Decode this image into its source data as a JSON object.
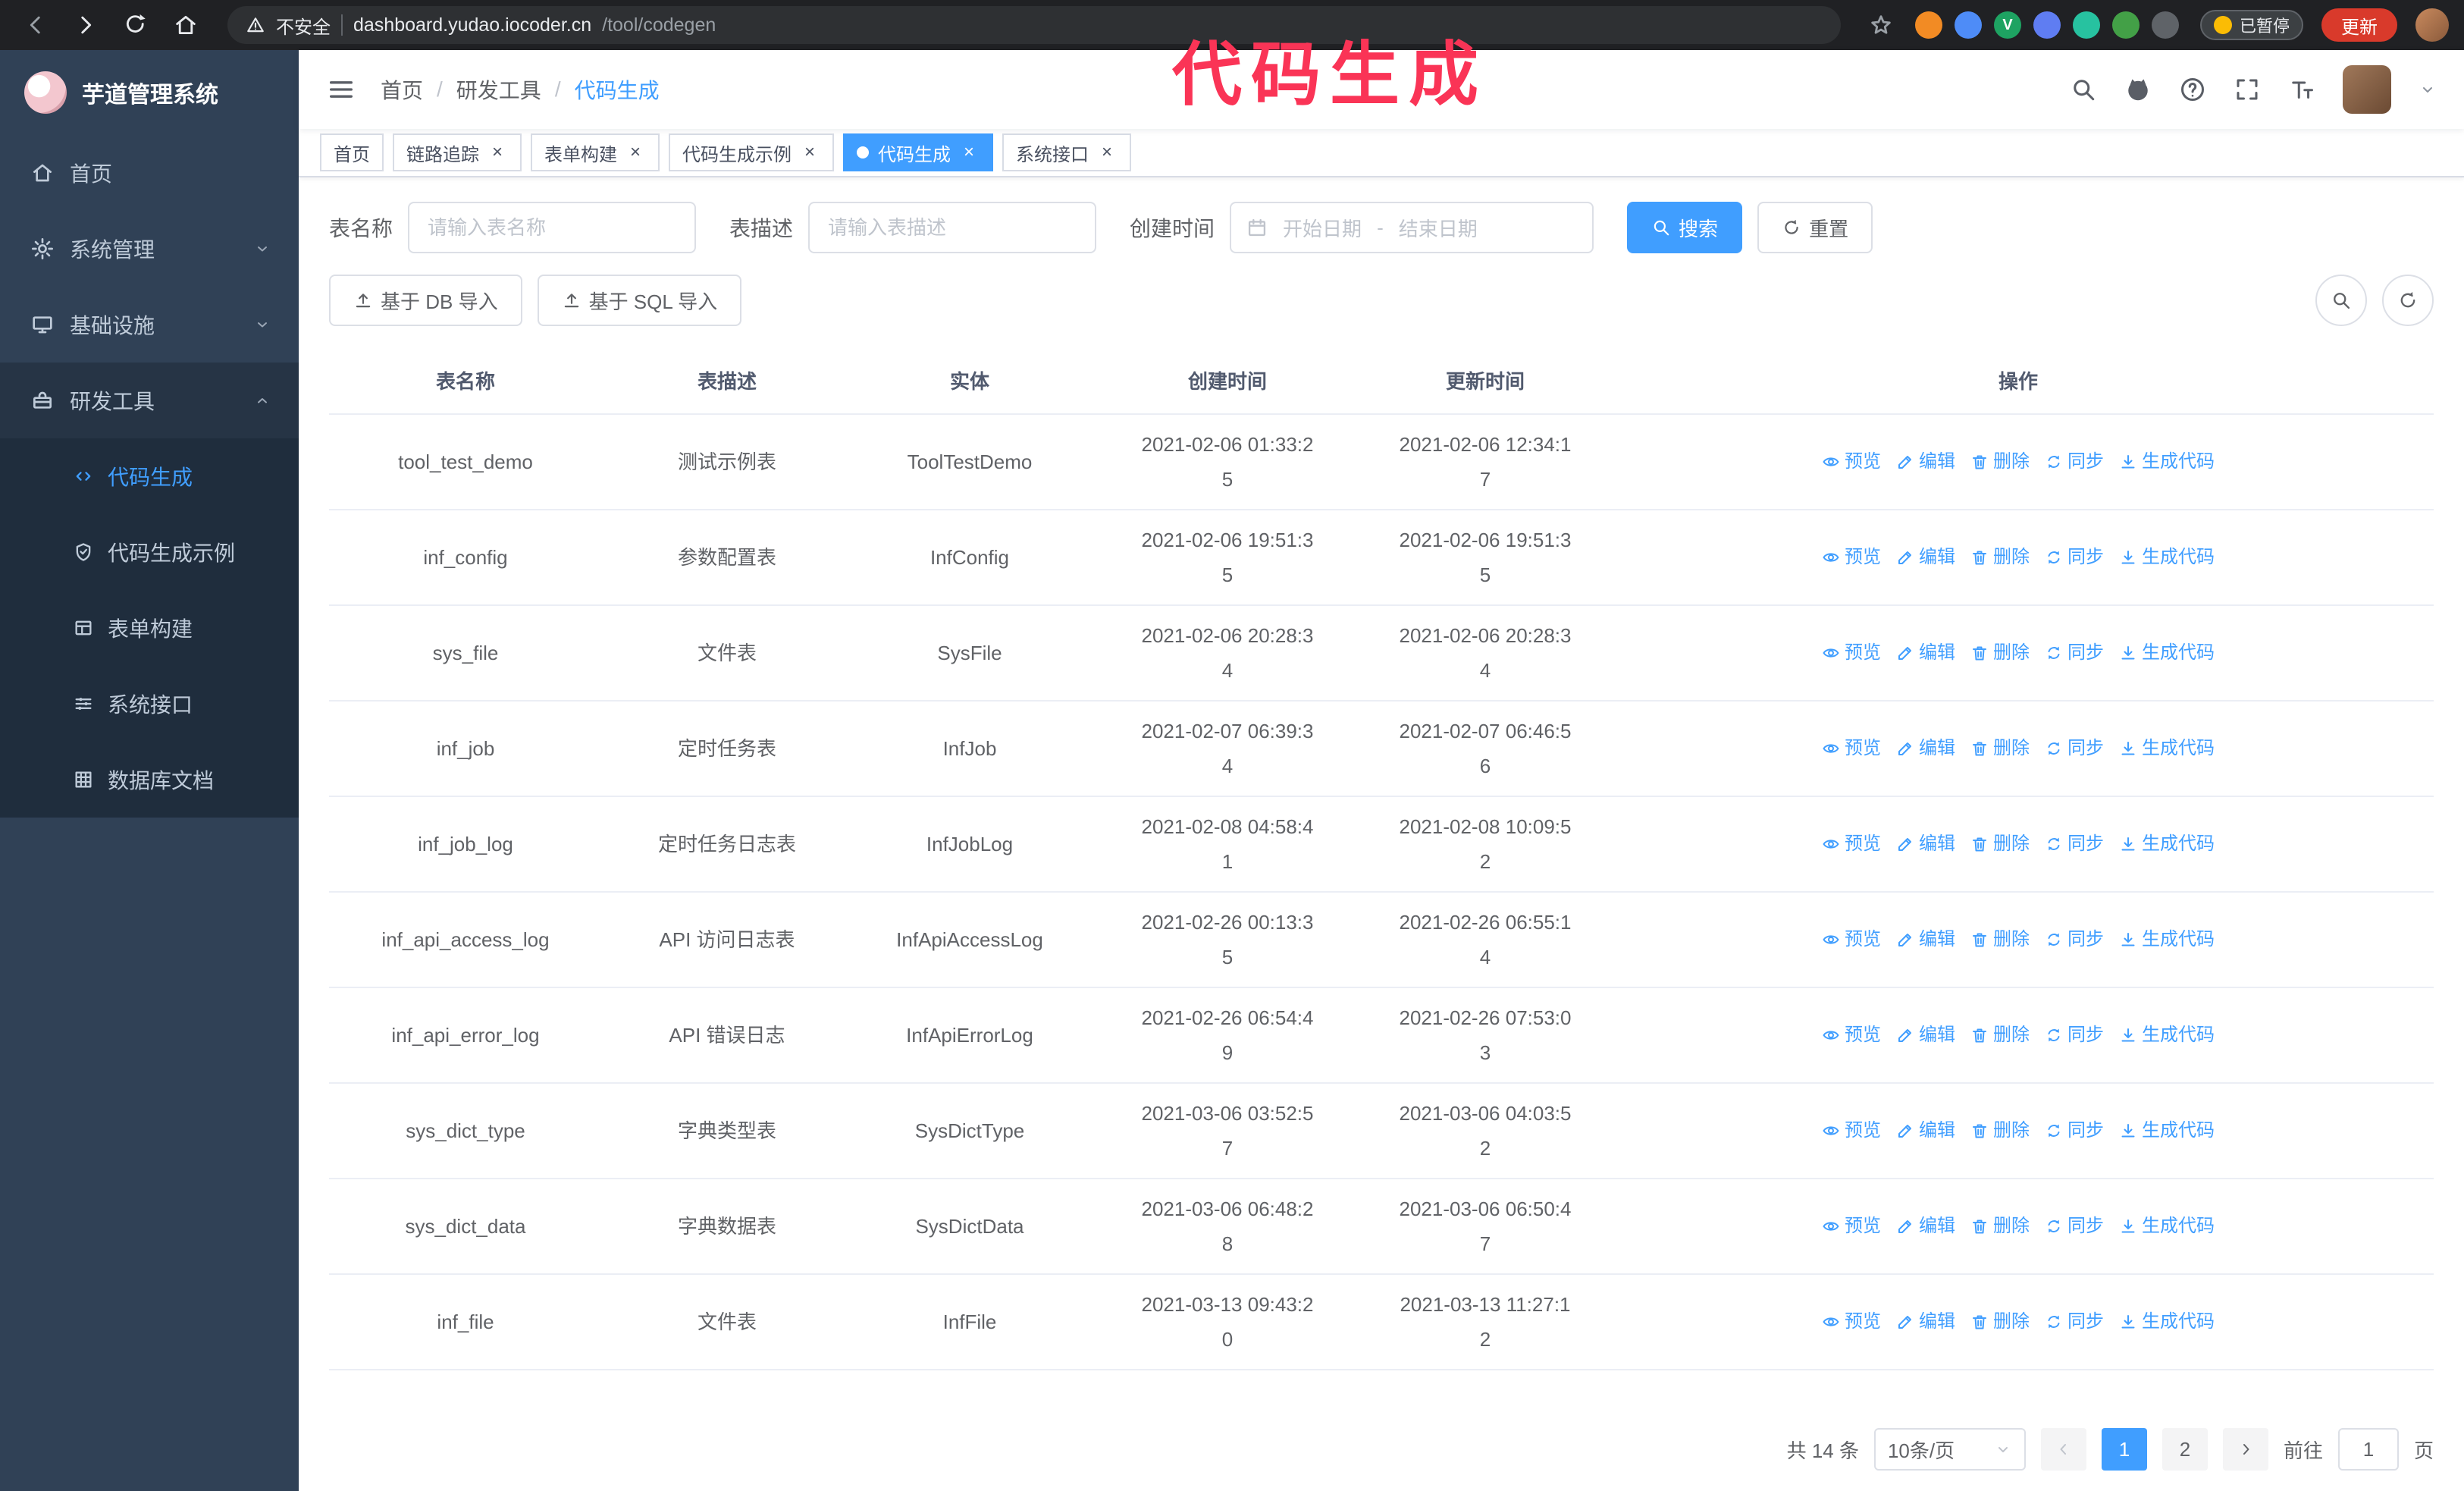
{
  "colors": {
    "accent": "#409eff",
    "sidebar_bg": "#304156",
    "submenu_bg": "#1f2d3d",
    "update_button": "#d93a2b",
    "annotation": "#fa3456"
  },
  "annotation": {
    "text": "代码生成"
  },
  "browser": {
    "security_label": "不安全",
    "url_host": "dashboard.yudao.iocoder.cn",
    "url_path": "/tool/codegen",
    "nav_icons": [
      "back",
      "forward",
      "reload",
      "home"
    ],
    "bookmark_icon": "star",
    "extensions": [
      {
        "name": "extension-icon-1",
        "color": "#f28b24",
        "glyph": ""
      },
      {
        "name": "extension-icon-2",
        "color": "#4e8cf7",
        "glyph": ""
      },
      {
        "name": "extension-icon-3",
        "color": "#1ea362",
        "glyph": "V"
      },
      {
        "name": "extension-icon-4",
        "color": "#5f7df2",
        "glyph": ""
      },
      {
        "name": "extension-icon-5",
        "color": "#27c2a0",
        "glyph": ""
      },
      {
        "name": "extension-icon-6",
        "color": "#43a047",
        "glyph": ""
      },
      {
        "name": "extension-icon-7",
        "color": "#5f6368",
        "glyph": ""
      }
    ],
    "paused_badge": "已暂停",
    "update_button": "更新"
  },
  "sidebar": {
    "app_title": "芋道管理系统",
    "menu": [
      {
        "label": "首页",
        "icon": "home",
        "key": "home"
      },
      {
        "label": "系统管理",
        "icon": "gear",
        "key": "system",
        "chevron": "down"
      },
      {
        "label": "基础设施",
        "icon": "monitor",
        "key": "infra",
        "chevron": "down"
      },
      {
        "label": "研发工具",
        "icon": "toolbox",
        "key": "devtools",
        "chevron": "up",
        "expanded": true
      }
    ],
    "submenu": [
      {
        "label": "代码生成",
        "icon": "code",
        "key": "codegen",
        "active": true
      },
      {
        "label": "代码生成示例",
        "icon": "shield",
        "key": "codegen-example"
      },
      {
        "label": "表单构建",
        "icon": "form",
        "key": "form-builder"
      },
      {
        "label": "系统接口",
        "icon": "sliders",
        "key": "system-api"
      },
      {
        "label": "数据库文档",
        "icon": "grid",
        "key": "db-doc"
      }
    ]
  },
  "header": {
    "breadcrumb": [
      "首页",
      "研发工具",
      "代码生成"
    ],
    "separator": "/",
    "right_icons": [
      "search",
      "github",
      "question",
      "fullscreen",
      "fontsize"
    ]
  },
  "tabs": [
    {
      "label": "首页",
      "closable": false
    },
    {
      "label": "链路追踪",
      "closable": true
    },
    {
      "label": "表单构建",
      "closable": true
    },
    {
      "label": "代码生成示例",
      "closable": true
    },
    {
      "label": "代码生成",
      "closable": true,
      "active": true
    },
    {
      "label": "系统接口",
      "closable": true
    }
  ],
  "filters": {
    "table_name_label": "表名称",
    "table_name_placeholder": "请输入表名称",
    "table_desc_label": "表描述",
    "table_desc_placeholder": "请输入表描述",
    "create_time_label": "创建时间",
    "date_start_placeholder": "开始日期",
    "date_separator": "-",
    "date_end_placeholder": "结束日期",
    "search_button": "搜索",
    "reset_button": "重置"
  },
  "toolbar": {
    "import_db": "基于 DB 导入",
    "import_sql": "基于 SQL 导入"
  },
  "table": {
    "columns": [
      "表名称",
      "表描述",
      "实体",
      "创建时间",
      "更新时间",
      "操作"
    ],
    "actions": [
      {
        "label": "预览",
        "icon": "eye",
        "key": "preview"
      },
      {
        "label": "编辑",
        "icon": "edit",
        "key": "edit"
      },
      {
        "label": "删除",
        "icon": "delete",
        "key": "delete"
      },
      {
        "label": "同步",
        "icon": "sync",
        "key": "sync"
      },
      {
        "label": "生成代码",
        "icon": "download",
        "key": "generate"
      }
    ],
    "rows": [
      {
        "name": "tool_test_demo",
        "desc": "测试示例表",
        "entity": "ToolTestDemo",
        "created": "2021-02-06 01:33:25",
        "updated": "2021-02-06 12:34:17"
      },
      {
        "name": "inf_config",
        "desc": "参数配置表",
        "entity": "InfConfig",
        "created": "2021-02-06 19:51:35",
        "updated": "2021-02-06 19:51:35"
      },
      {
        "name": "sys_file",
        "desc": "文件表",
        "entity": "SysFile",
        "created": "2021-02-06 20:28:34",
        "updated": "2021-02-06 20:28:34"
      },
      {
        "name": "inf_job",
        "desc": "定时任务表",
        "entity": "InfJob",
        "created": "2021-02-07 06:39:34",
        "updated": "2021-02-07 06:46:56"
      },
      {
        "name": "inf_job_log",
        "desc": "定时任务日志表",
        "entity": "InfJobLog",
        "created": "2021-02-08 04:58:41",
        "updated": "2021-02-08 10:09:52"
      },
      {
        "name": "inf_api_access_log",
        "desc": "API 访问日志表",
        "entity": "InfApiAccessLog",
        "created": "2021-02-26 00:13:35",
        "updated": "2021-02-26 06:55:14"
      },
      {
        "name": "inf_api_error_log",
        "desc": "API 错误日志",
        "entity": "InfApiErrorLog",
        "created": "2021-02-26 06:54:49",
        "updated": "2021-02-26 07:53:03"
      },
      {
        "name": "sys_dict_type",
        "desc": "字典类型表",
        "entity": "SysDictType",
        "created": "2021-03-06 03:52:57",
        "updated": "2021-03-06 04:03:52"
      },
      {
        "name": "sys_dict_data",
        "desc": "字典数据表",
        "entity": "SysDictData",
        "created": "2021-03-06 06:48:28",
        "updated": "2021-03-06 06:50:47"
      },
      {
        "name": "inf_file",
        "desc": "文件表",
        "entity": "InfFile",
        "created": "2021-03-13 09:43:20",
        "updated": "2021-03-13 11:27:12"
      }
    ]
  },
  "pagination": {
    "total_text": "共 14 条",
    "page_size": "10条/页",
    "pages": [
      {
        "label": "1",
        "active": true
      },
      {
        "label": "2",
        "active": false
      }
    ],
    "goto_prefix": "前往",
    "goto_value": "1",
    "goto_suffix": "页"
  }
}
